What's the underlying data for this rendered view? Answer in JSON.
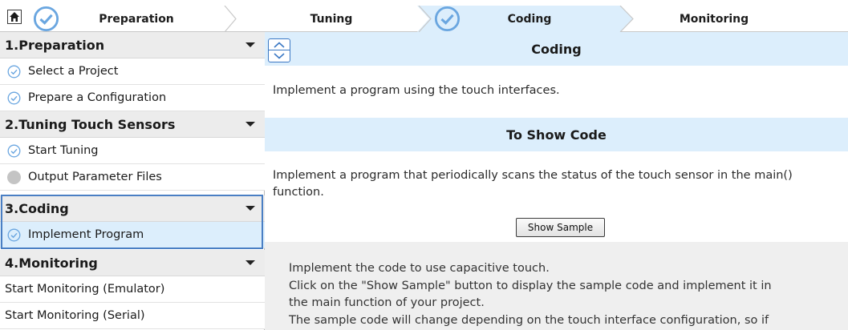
{
  "stepper": {
    "steps": [
      {
        "label": "Preparation",
        "checked": true
      },
      {
        "label": "Tuning",
        "checked": false
      },
      {
        "label": "Coding",
        "checked": true,
        "active": true
      },
      {
        "label": "Monitoring",
        "checked": false
      }
    ]
  },
  "sidebar": {
    "sections": [
      {
        "title": "1.Preparation",
        "items": [
          {
            "label": "Select a Project",
            "status": "checked"
          },
          {
            "label": "Prepare a Configuration",
            "status": "checked"
          }
        ]
      },
      {
        "title": "2.Tuning Touch Sensors",
        "items": [
          {
            "label": "Start Tuning",
            "status": "checked"
          },
          {
            "label": "Output Parameter Files",
            "status": "pending"
          }
        ]
      },
      {
        "title": "3.Coding",
        "items": [
          {
            "label": "Implement Program",
            "status": "checked",
            "selected": true
          }
        ]
      },
      {
        "title": "4.Monitoring",
        "items": [
          {
            "label": "Start Monitoring (Emulator)",
            "status": "none"
          },
          {
            "label": "Start Monitoring (Serial)",
            "status": "none"
          }
        ]
      }
    ]
  },
  "main": {
    "header_title": "Coding",
    "intro": "Implement a program using the touch interfaces.",
    "subheader_title": "To Show Code",
    "description_line1": "Implement a program that periodically scans the status of the touch sensor in the main()",
    "description_line2": "function.",
    "show_sample_label": "Show Sample",
    "note_lines": [
      "Implement the code to use capacitive touch.",
      "Click on the \"Show Sample\" button to display the sample code and implement it in",
      "the main function of your project.",
      "The sample code will change depending on the touch interface configuration, so if"
    ]
  },
  "colors": {
    "accent_blue": "#3b78c4",
    "header_bg": "#dceefc",
    "section_bg": "#ececec",
    "check_icon": "#6aa6e0"
  },
  "icons": {
    "home": "home-icon",
    "check": "check-circle-icon",
    "pending": "gray-dot-icon",
    "collapse": "triangle-down-icon",
    "scroll_up": "chevron-up-icon",
    "scroll_down": "chevron-down-icon"
  }
}
